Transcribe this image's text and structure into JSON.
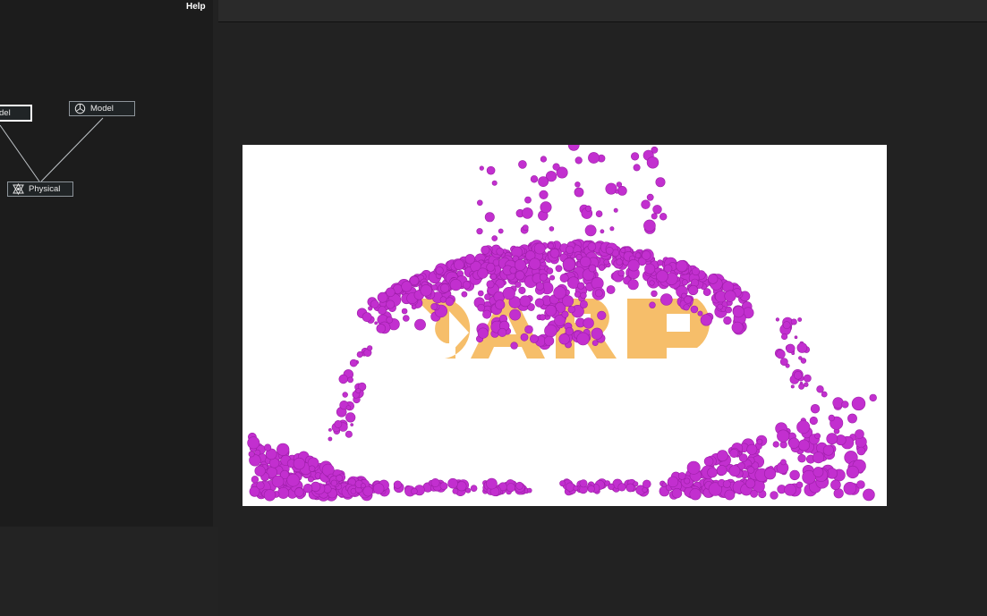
{
  "menu": {
    "help_label": "Help"
  },
  "graph": {
    "nodes": [
      {
        "label": "del"
      },
      {
        "label": "Model"
      },
      {
        "label": "Physical"
      }
    ]
  },
  "viewport": {
    "logo_text": "CARP",
    "colors": {
      "logo": "#f6be6a",
      "particles": "#c22fcf",
      "background": "#ffffff"
    }
  }
}
